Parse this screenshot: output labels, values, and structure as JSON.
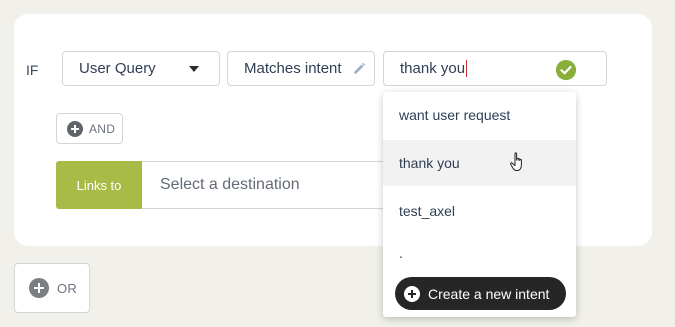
{
  "condition": {
    "if_label": "IF",
    "field_select": {
      "value": "User Query",
      "icon": "chevron-down-icon"
    },
    "operator_select": {
      "value": "Matches intent",
      "icon": "pencil-icon"
    },
    "value_input": {
      "value": "thank you",
      "valid_icon": "check-circle-icon",
      "valid_color": "#8aae3a"
    }
  },
  "and_button": {
    "label": "AND",
    "icon": "plus-circle-icon"
  },
  "links": {
    "tag_label": "Links to",
    "tag_color": "#a9bb47",
    "destination_placeholder": "Select a destination"
  },
  "or_button": {
    "label": "OR",
    "icon": "plus-circle-icon"
  },
  "dropdown": {
    "items": [
      {
        "label": "want user request"
      },
      {
        "label": "thank you"
      },
      {
        "label": "test_axel"
      },
      {
        "label": "."
      }
    ],
    "hovered_index": 1,
    "create_label": "Create a new intent",
    "create_icon": "plus-circle-icon"
  }
}
